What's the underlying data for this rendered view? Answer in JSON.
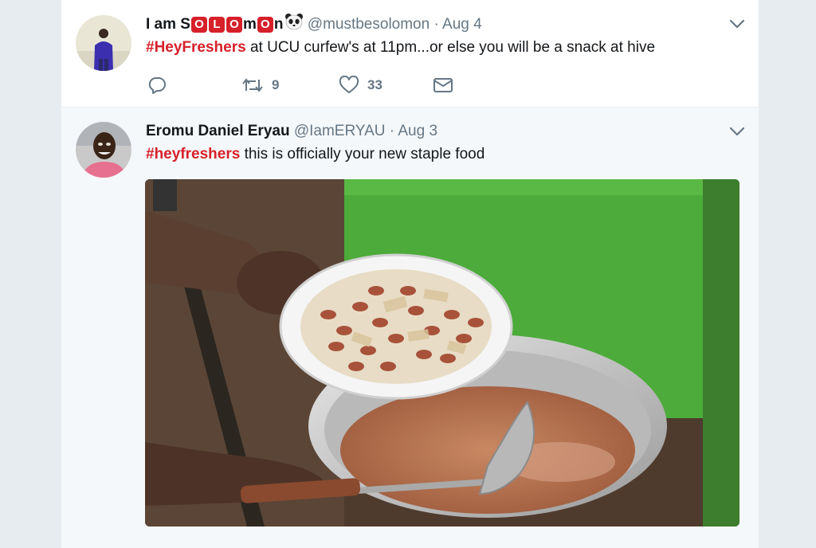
{
  "tweets": [
    {
      "display_name_prefix": "I am S",
      "name_boxes": [
        "O",
        "L",
        "O",
        "m",
        "O",
        "n"
      ],
      "handle": "@mustbesolomon",
      "separator": "·",
      "date": "Aug 4",
      "hashtag": "#HeyFreshers",
      "body": " at UCU curfew's at 11pm...or else you will be a snack at hive",
      "reply_count": "",
      "retweet_count": "9",
      "like_count": "33",
      "icons": {
        "reply": "reply-icon",
        "retweet": "retweet-icon",
        "like": "heart-icon",
        "dm": "envelope-icon",
        "more": "chevron-down-icon",
        "emoji": "panda-icon"
      }
    },
    {
      "display_name": "Eromu Daniel Eryau",
      "handle": "@IamERYAU",
      "separator": "·",
      "date": "Aug 3",
      "hashtag": "#heyfreshers",
      "body": " this is officially your new staple food",
      "icons": {
        "more": "chevron-down-icon",
        "photo": "beans-plate-photo"
      }
    }
  ],
  "colors": {
    "accent": "#d6202a",
    "secondary_text": "#657786",
    "background": "#e6ecf0"
  }
}
